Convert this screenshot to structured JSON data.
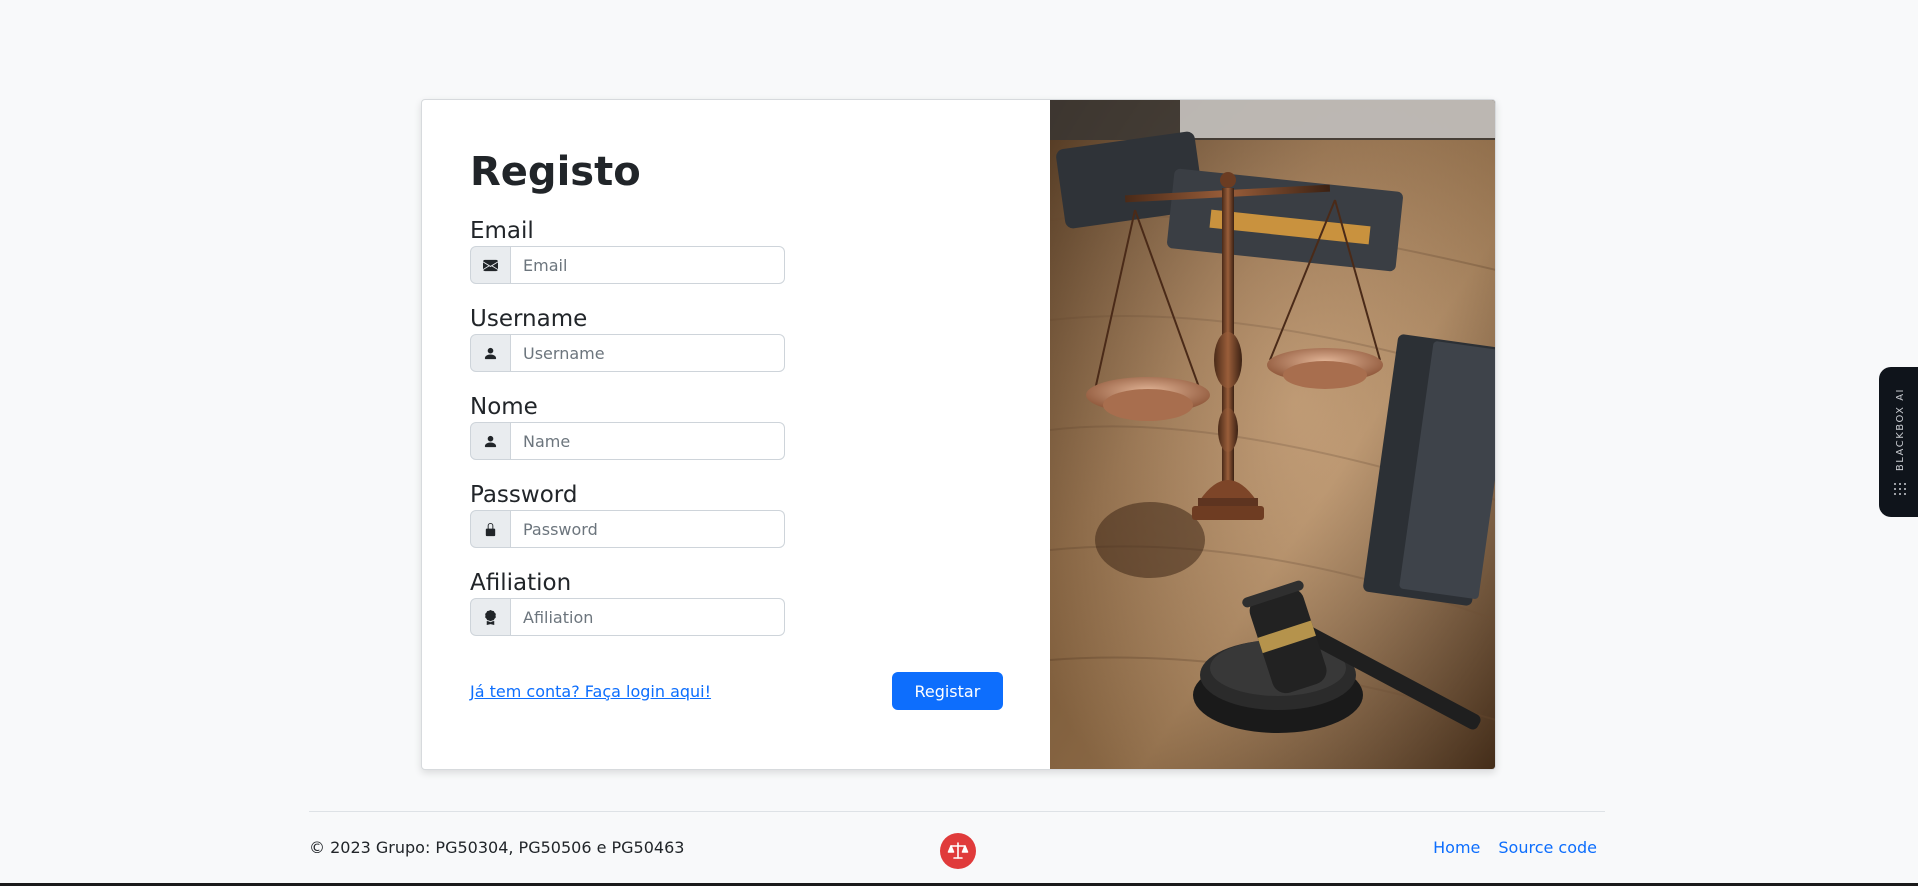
{
  "form": {
    "title": "Registo",
    "fields": [
      {
        "label": "Email",
        "placeholder": "Email",
        "icon": "envelope-icon"
      },
      {
        "label": "Username",
        "placeholder": "Username",
        "icon": "person-icon"
      },
      {
        "label": "Nome",
        "placeholder": "Name",
        "icon": "person-icon"
      },
      {
        "label": "Password",
        "placeholder": "Password",
        "icon": "lock-icon"
      },
      {
        "label": "Afiliation",
        "placeholder": "Afiliation",
        "icon": "award-icon"
      }
    ],
    "login_link": "Já tem conta? Faça login aqui!",
    "submit_label": "Registar"
  },
  "image": {
    "subject": "scales-of-justice-and-gavel"
  },
  "footer": {
    "copyright": "© 2023 Grupo: PG50304, PG50506 e PG50463",
    "logo_icon": "scales-icon",
    "nav": [
      "Home",
      "Source code"
    ]
  },
  "side_widget": {
    "label": "BLACKBOX AI"
  },
  "colors": {
    "primary": "#0d6efd",
    "background": "#f8f9fa",
    "logo": "#e03b3b"
  }
}
